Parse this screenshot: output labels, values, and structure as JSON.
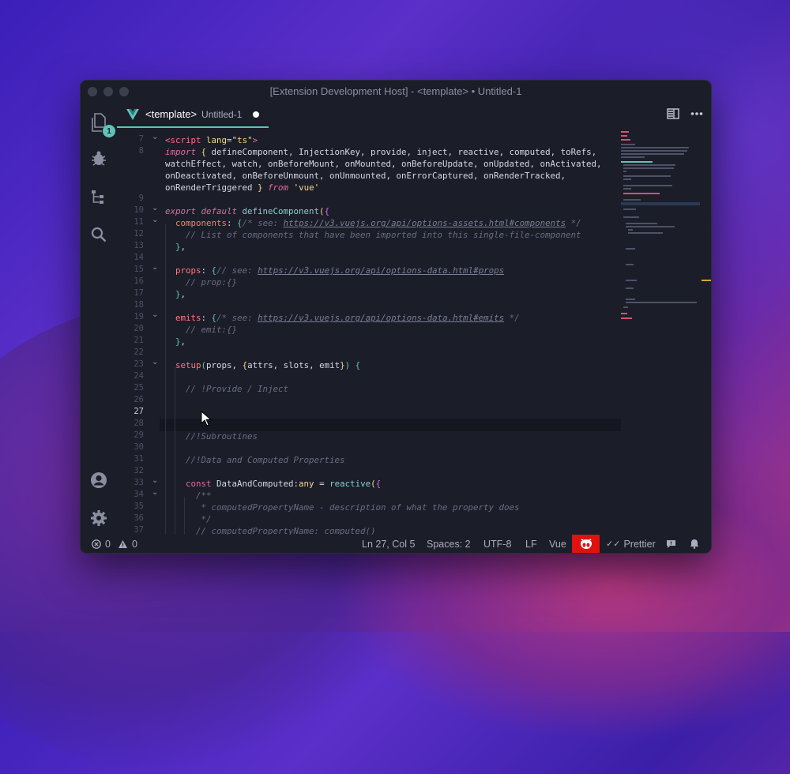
{
  "window": {
    "title": "[Extension Development Host] - <template> • Untitled-1"
  },
  "activity": {
    "explorer_badge": "1"
  },
  "tab": {
    "name": "<template>",
    "description": "Untitled-1"
  },
  "editor": {
    "cursor_line": 27,
    "lines": [
      {
        "n": "7",
        "fold": "⌄",
        "html": "<span class='tag'>&lt;script</span> <span class='attr'>lang</span>=<span class='str'>\"ts\"</span><span class='tag'>&gt;</span>"
      },
      {
        "n": "8",
        "fold": "",
        "html": "<span class='kw it'>import</span> <span class='br3'>{</span> defineComponent, InjectionKey, provide, inject, reactive, computed, toRefs,"
      },
      {
        "n": "",
        "fold": "",
        "html": "watchEffect, watch, onBeforeMount, onMounted, onBeforeUpdate, onUpdated, onActivated,"
      },
      {
        "n": "",
        "fold": "",
        "html": "onDeactivated, onBeforeUnmount, onUnmounted, onErrorCaptured, onRenderTracked,"
      },
      {
        "n": "",
        "fold": "",
        "html": "onRenderTriggered <span class='br3'>}</span> <span class='kw it'>from</span> <span class='str'>'vue'</span>"
      },
      {
        "n": "9",
        "fold": "",
        "html": ""
      },
      {
        "n": "10",
        "fold": "⌄",
        "html": "<span class='kw it'>export default</span> <span class='fn'>defineComponent</span><span class='br3'>(</span><span class='br'>{</span>"
      },
      {
        "n": "11",
        "fold": "⌄",
        "html": "  <span class='prop'>components</span>: <span class='br2'>{</span><span class='com'>/* see: </span><span class='url'>https://v3.vuejs.org/api/options-assets.html#components</span><span class='com'> */</span>"
      },
      {
        "n": "12",
        "fold": "",
        "html": "    <span class='com'>// List of components that have been imported into this single-file-component</span>"
      },
      {
        "n": "13",
        "fold": "",
        "html": "  <span class='br2'>}</span>,"
      },
      {
        "n": "14",
        "fold": "",
        "html": ""
      },
      {
        "n": "15",
        "fold": "⌄",
        "html": "  <span class='prop'>props</span>: <span class='br2'>{</span><span class='com'>// see: </span><span class='url'>https://v3.vuejs.org/api/options-data.html#props</span>"
      },
      {
        "n": "16",
        "fold": "",
        "html": "    <span class='com'>// prop:{}</span>"
      },
      {
        "n": "17",
        "fold": "",
        "html": "  <span class='br2'>}</span>,"
      },
      {
        "n": "18",
        "fold": "",
        "html": ""
      },
      {
        "n": "19",
        "fold": "⌄",
        "html": "  <span class='prop'>emits</span>: <span class='br2'>{</span><span class='com'>/* see: </span><span class='url'>https://v3.vuejs.org/api/options-data.html#emits</span><span class='com'> */</span>"
      },
      {
        "n": "20",
        "fold": "",
        "html": "    <span class='com'>// emit:{}</span>"
      },
      {
        "n": "21",
        "fold": "",
        "html": "  <span class='br2'>}</span>,"
      },
      {
        "n": "22",
        "fold": "",
        "html": ""
      },
      {
        "n": "23",
        "fold": "⌄",
        "html": "  <span class='prop'>setup</span><span class='br2'>(</span>props, <span class='br3'>{</span>attrs, slots, emit<span class='br3'>}</span><span class='br2'>)</span> <span class='br2'>{</span>"
      },
      {
        "n": "24",
        "fold": "",
        "html": ""
      },
      {
        "n": "25",
        "fold": "",
        "html": "    <span class='com'>// !Provide / Inject</span>"
      },
      {
        "n": "26",
        "fold": "",
        "html": ""
      },
      {
        "n": "27",
        "fold": "",
        "html": ""
      },
      {
        "n": "28",
        "fold": "",
        "html": ""
      },
      {
        "n": "29",
        "fold": "",
        "html": "    <span class='com'>//!Subroutines</span>"
      },
      {
        "n": "30",
        "fold": "",
        "html": ""
      },
      {
        "n": "31",
        "fold": "",
        "html": "    <span class='com'>//!Data and Computed Properties</span>"
      },
      {
        "n": "32",
        "fold": "",
        "html": ""
      },
      {
        "n": "33",
        "fold": "⌄",
        "html": "    <span class='k'>const</span> DataAndComputed:<span class='ty'>any</span> = <span class='fn'>reactive</span><span class='br3'>(</span><span class='br'>{</span>"
      },
      {
        "n": "34",
        "fold": "⌄",
        "html": "      <span class='com'>/**</span>"
      },
      {
        "n": "35",
        "fold": "",
        "html": "       <span class='com'>* computedPropertyName - description of what the property does</span>"
      },
      {
        "n": "36",
        "fold": "",
        "html": "       <span class='com'>*/</span>"
      },
      {
        "n": "37",
        "fold": "",
        "html": "      <span class='com'>// computedPropertyName: computed()</span>"
      }
    ]
  },
  "status": {
    "errors": "0",
    "warnings": "0",
    "position": "Ln 27, Col 5",
    "spaces": "Spaces: 2",
    "encoding": "UTF-8",
    "eol": "LF",
    "language": "Vue",
    "prettier": "Prettier"
  },
  "colors": {
    "accent": "#5ec4b8",
    "status_accent": "#e0120f"
  }
}
